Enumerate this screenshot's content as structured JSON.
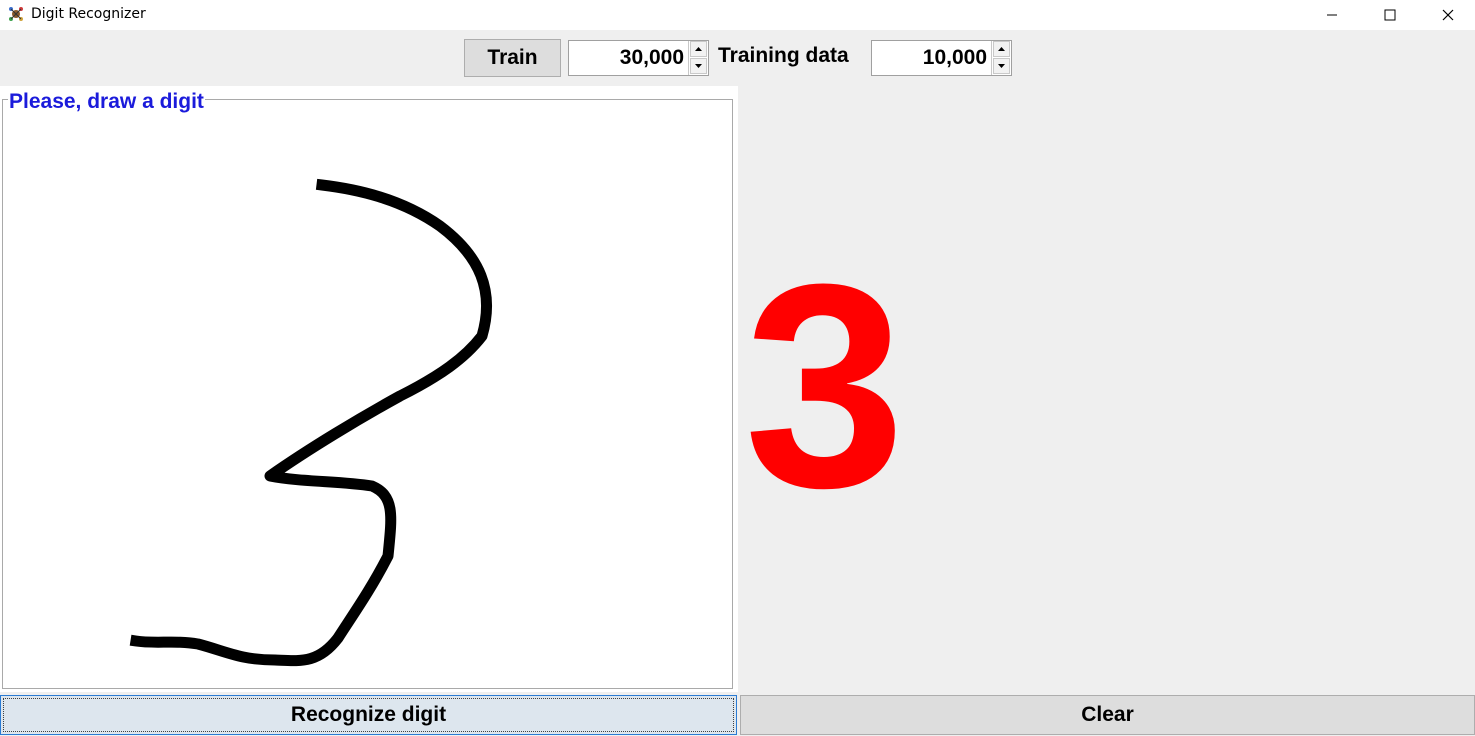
{
  "window": {
    "title": "Digit Recognizer",
    "icon": "app-icon",
    "controls": [
      "minimize-icon",
      "maximize-icon",
      "close-icon"
    ]
  },
  "toolbar": {
    "train_label": "Train",
    "iterations_value": "30,000",
    "training_data_label": "Training data",
    "training_data_value": "10,000"
  },
  "canvas": {
    "title": "Please, draw a digit",
    "title_color": "#1b1bdb",
    "stroke_color": "#000000"
  },
  "result": {
    "digit": "3",
    "color": "#ff0000"
  },
  "actions": {
    "recognize_label": "Recognize digit",
    "clear_label": "Clear"
  }
}
